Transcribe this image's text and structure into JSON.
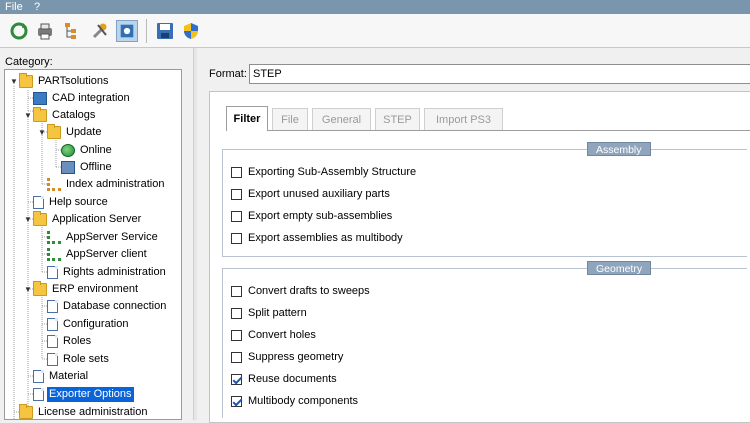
{
  "menu": {
    "file": "File",
    "help": "?"
  },
  "toolbar": {
    "icons": [
      "refresh-icon",
      "print-icon",
      "hierarchy-icon",
      "tools-icon",
      "gear-icon",
      "save-icon",
      "shield-icon"
    ]
  },
  "category": {
    "label": "Category:",
    "items": [
      {
        "label": "PARTsolutions",
        "icon": "folder-icon",
        "expanded": true
      },
      {
        "label": "CAD integration",
        "icon": "gear-icon"
      },
      {
        "label": "Catalogs",
        "icon": "folder-icon",
        "expanded": true
      },
      {
        "label": "Update",
        "icon": "folder-icon",
        "expanded": true
      },
      {
        "label": "Online",
        "icon": "globe-icon"
      },
      {
        "label": "Offline",
        "icon": "computer-icon"
      },
      {
        "label": "Index administration",
        "icon": "index-icon"
      },
      {
        "label": "Help source",
        "icon": "document-icon"
      },
      {
        "label": "Application Server",
        "icon": "folder-icon",
        "expanded": true
      },
      {
        "label": "AppServer Service",
        "icon": "server-icon"
      },
      {
        "label": "AppServer client",
        "icon": "server-icon"
      },
      {
        "label": "Rights administration",
        "icon": "document-icon"
      },
      {
        "label": "ERP environment",
        "icon": "folder-icon",
        "expanded": true
      },
      {
        "label": "Database connection",
        "icon": "document-icon"
      },
      {
        "label": "Configuration",
        "icon": "document-icon"
      },
      {
        "label": "Roles",
        "icon": "document-icon"
      },
      {
        "label": "Role sets",
        "icon": "document-icon"
      },
      {
        "label": "Material",
        "icon": "document-icon"
      },
      {
        "label": "Exporter Options",
        "icon": "document-icon",
        "selected": true
      },
      {
        "label": "License administration",
        "icon": "folder-icon"
      }
    ]
  },
  "format": {
    "label": "Format:",
    "value": "STEP"
  },
  "tabs": [
    {
      "label": "Filter",
      "active": true
    },
    {
      "label": "File"
    },
    {
      "label": "General"
    },
    {
      "label": "STEP"
    },
    {
      "label": "Import PS3"
    }
  ],
  "groups": {
    "assembly": {
      "title": "Assembly",
      "options": [
        {
          "label": "Exporting Sub-Assembly Structure",
          "checked": false
        },
        {
          "label": "Export unused auxiliary parts",
          "checked": false
        },
        {
          "label": "Export empty sub-assemblies",
          "checked": false
        },
        {
          "label": "Export assemblies as multibody",
          "checked": false
        }
      ]
    },
    "geometry": {
      "title": "Geometry",
      "options": [
        {
          "label": "Convert drafts to sweeps",
          "checked": false
        },
        {
          "label": "Split pattern",
          "checked": false
        },
        {
          "label": "Convert holes",
          "checked": false
        },
        {
          "label": "Suppress geometry",
          "checked": false
        },
        {
          "label": "Reuse documents",
          "checked": true
        },
        {
          "label": "Multibody components",
          "checked": true
        }
      ]
    }
  }
}
